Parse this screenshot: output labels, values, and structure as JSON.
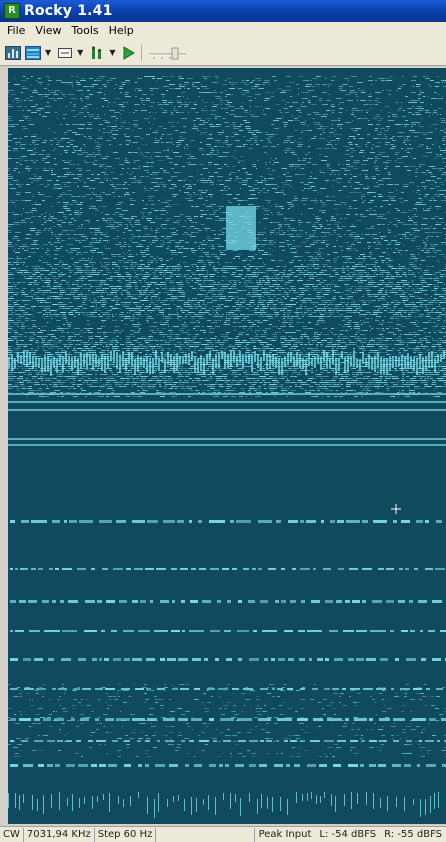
{
  "window": {
    "title": "Rocky 1.41"
  },
  "menu": {
    "items": [
      "File",
      "View",
      "Tools",
      "Help"
    ]
  },
  "toolbar": {
    "buttons": [
      {
        "icon": "spectrum-icon"
      },
      {
        "icon": "waterfall-icon"
      },
      {
        "icon": "display-mode-icon"
      },
      {
        "icon": "bandwidth-icon"
      },
      {
        "icon": "play-icon"
      },
      {
        "icon": "slider-icon"
      }
    ]
  },
  "status": {
    "mode": "CW",
    "frequency": "7031,94 KHz",
    "step": "Step 60 Hz",
    "peak_label": "Peak Input",
    "left_level": "L: -54 dBFS",
    "right_level": "R: -55 dBFS"
  },
  "colors": {
    "waterfall_background": "#0f4a5f",
    "signal": "#7fe3ee",
    "title_bar": "#0a3ea8"
  }
}
